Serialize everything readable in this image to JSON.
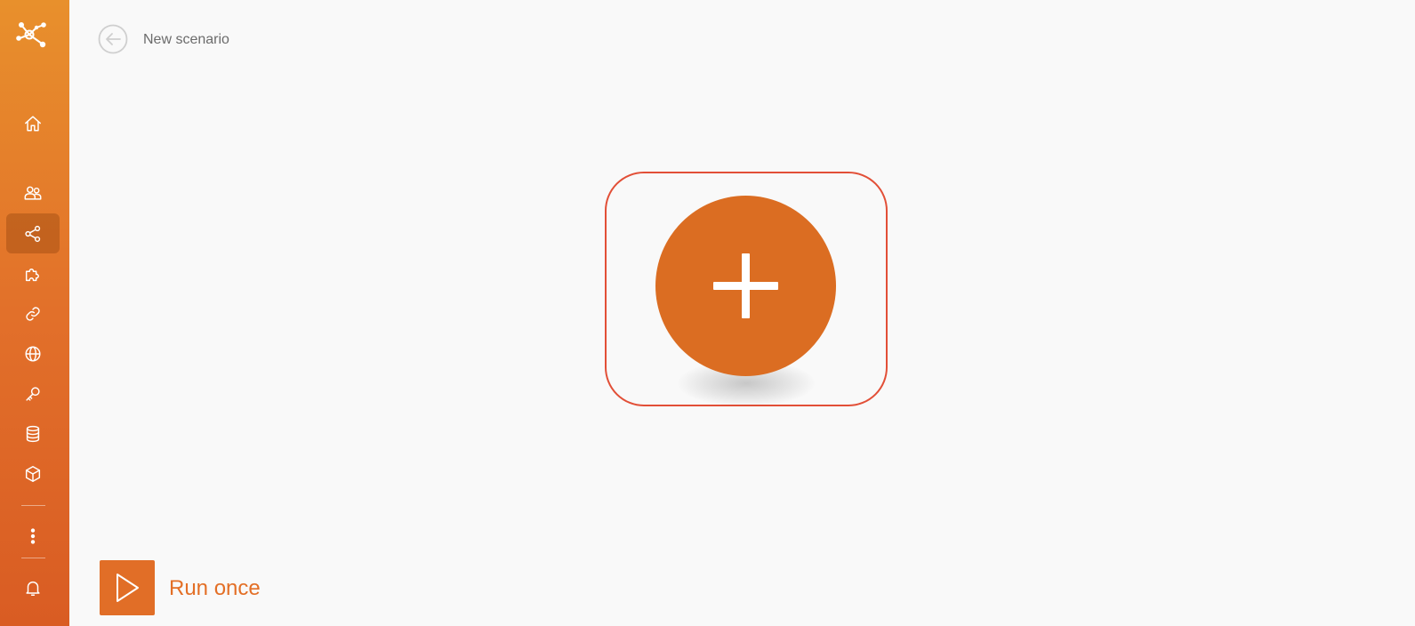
{
  "sidebar": {
    "logo_icon": "make-logo-icon",
    "items": [
      {
        "name": "home",
        "icon": "home-icon"
      },
      {
        "name": "team",
        "icon": "users-icon"
      },
      {
        "name": "scenarios",
        "icon": "share-icon",
        "active": true
      },
      {
        "name": "apps",
        "icon": "puzzle-icon"
      },
      {
        "name": "connections",
        "icon": "link-icon"
      },
      {
        "name": "webhooks",
        "icon": "globe-icon"
      },
      {
        "name": "keys",
        "icon": "key-icon"
      },
      {
        "name": "data-stores",
        "icon": "database-icon"
      },
      {
        "name": "data-structures",
        "icon": "cube-icon"
      },
      {
        "name": "more",
        "icon": "more-vertical-icon"
      },
      {
        "name": "notifications",
        "icon": "bell-icon"
      }
    ],
    "gradient": [
      "#e8902c",
      "#d95c23"
    ]
  },
  "header": {
    "back_icon": "arrow-left-circle-icon",
    "title": "New scenario"
  },
  "canvas": {
    "add_module_icon": "plus-icon",
    "accent_color": "#db6d22",
    "highlight_color": "#e24f37"
  },
  "footer": {
    "run_icon": "play-icon",
    "run_label": "Run once"
  }
}
